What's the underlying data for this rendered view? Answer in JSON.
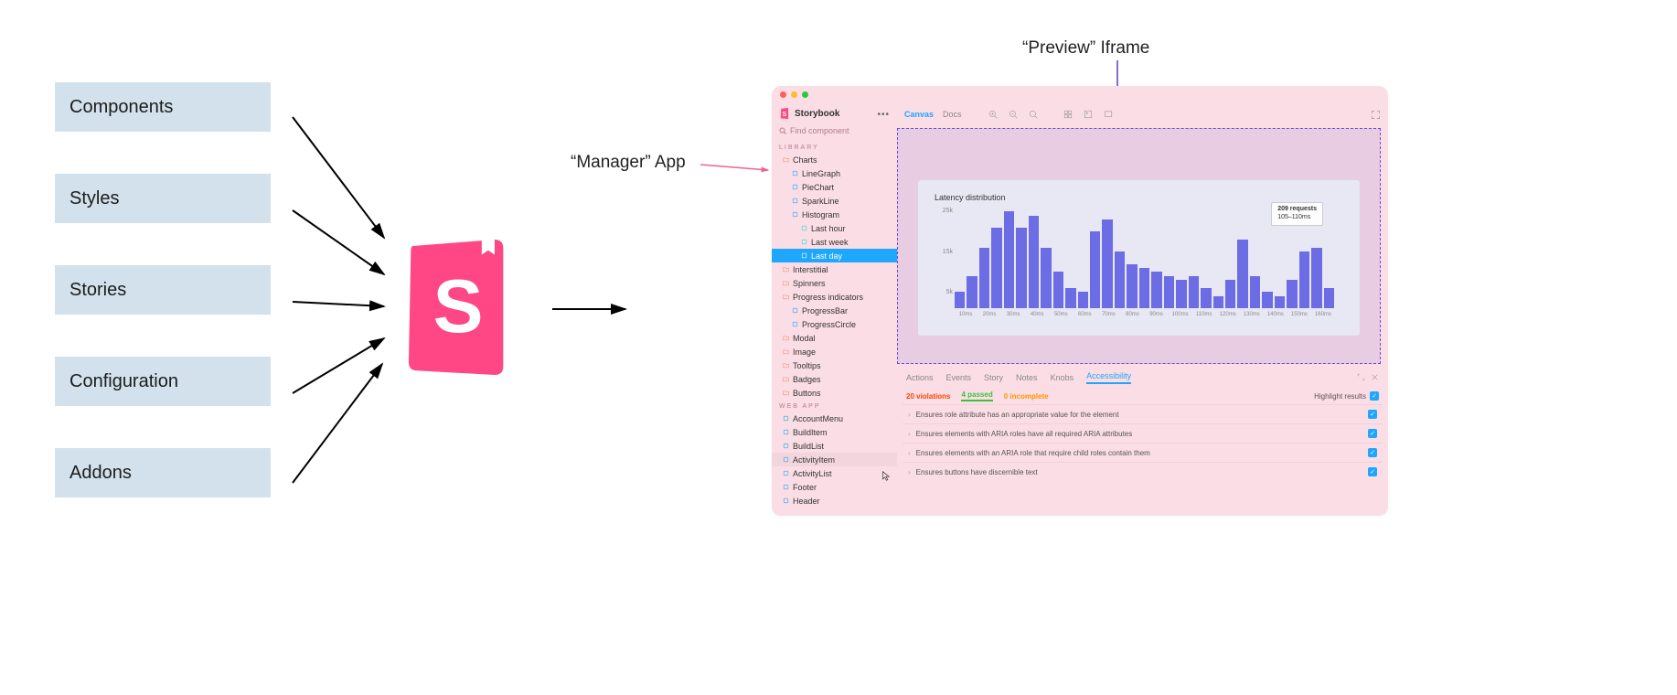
{
  "inputs": [
    "Components",
    "Styles",
    "Stories",
    "Configuration",
    "Addons"
  ],
  "labels": {
    "manager": "“Manager” App",
    "preview": "“Preview” Iframe"
  },
  "app": {
    "title": "Storybook",
    "search_placeholder": "Find component",
    "menu_dots": "•••",
    "sections": {
      "library_header": "LIBRARY",
      "webapp_header": "WEB APP"
    },
    "library": [
      {
        "label": "Charts",
        "indent": 0,
        "icon": "folder"
      },
      {
        "label": "LineGraph",
        "indent": 1,
        "icon": "component"
      },
      {
        "label": "PieChart",
        "indent": 1,
        "icon": "component"
      },
      {
        "label": "SparkLine",
        "indent": 1,
        "icon": "component"
      },
      {
        "label": "Histogram",
        "indent": 1,
        "icon": "component-open"
      },
      {
        "label": "Last hour",
        "indent": 2,
        "icon": "story"
      },
      {
        "label": "Last week",
        "indent": 2,
        "icon": "story"
      },
      {
        "label": "Last day",
        "indent": 2,
        "icon": "story",
        "selected": true
      },
      {
        "label": "Interstitial",
        "indent": 0,
        "icon": "folder"
      },
      {
        "label": "Spinners",
        "indent": 0,
        "icon": "folder"
      },
      {
        "label": "Progress indicators",
        "indent": 0,
        "icon": "folder-open"
      },
      {
        "label": "ProgressBar",
        "indent": 1,
        "icon": "component"
      },
      {
        "label": "ProgressCircle",
        "indent": 1,
        "icon": "component"
      },
      {
        "label": "Modal",
        "indent": 0,
        "icon": "folder"
      },
      {
        "label": "Image",
        "indent": 0,
        "icon": "folder"
      },
      {
        "label": "Tooltips",
        "indent": 0,
        "icon": "folder"
      },
      {
        "label": "Badges",
        "indent": 0,
        "icon": "folder"
      },
      {
        "label": "Buttons",
        "indent": 0,
        "icon": "folder"
      }
    ],
    "webapp": [
      {
        "label": "AccountMenu",
        "icon": "component"
      },
      {
        "label": "BuildItem",
        "icon": "component"
      },
      {
        "label": "BuildList",
        "icon": "component"
      },
      {
        "label": "ActivityItem",
        "icon": "component",
        "hover": true
      },
      {
        "label": "ActivityList",
        "icon": "component"
      },
      {
        "label": "Footer",
        "icon": "component"
      },
      {
        "label": "Header",
        "icon": "component"
      }
    ],
    "toolbar": {
      "canvas": "Canvas",
      "docs": "Docs",
      "icons": [
        "zoom-in-icon",
        "zoom-out-icon",
        "zoom-reset-icon",
        "grid-icon",
        "background-icon",
        "viewport-icon"
      ],
      "fullscreen_icon": "fullscreen-icon"
    },
    "addons": {
      "tabs": [
        "Actions",
        "Events",
        "Story",
        "Notes",
        "Knobs",
        "Accessibility"
      ],
      "active_tab": "Accessibility",
      "counts": {
        "violations": "20 violations",
        "passed": "4 passed",
        "incomplete": "0 incomplete"
      },
      "highlight_label": "Highlight results",
      "right_icons": [
        "expand-icon",
        "close-icon"
      ],
      "rows": [
        "Ensures role attribute has an appropriate value for the element",
        "Ensures elements with ARIA roles have all required ARIA attributes",
        "Ensures elements with an ARIA role that require child roles contain them",
        "Ensures buttons have discernible text"
      ]
    }
  },
  "chart_data": {
    "type": "bar",
    "title": "Latency distribution",
    "ylabel": "",
    "xlabel": "",
    "ylim": [
      0,
      25000
    ],
    "y_ticks": [
      "25k",
      "15k",
      "5k"
    ],
    "categories": [
      "10ms",
      "20ms",
      "30ms",
      "40ms",
      "50ms",
      "60ms",
      "70ms",
      "80ms",
      "90ms",
      "100ms",
      "110ms",
      "120ms",
      "130ms",
      "140ms",
      "150ms",
      "160ms"
    ],
    "values": [
      4000,
      8000,
      15000,
      20000,
      24000,
      20000,
      23000,
      15000,
      9000,
      5000,
      4000,
      19000,
      22000,
      14000,
      11000,
      10000,
      9000,
      8000,
      7000,
      8000,
      5000,
      3000,
      7000,
      17000,
      8000,
      4000,
      3000,
      7000,
      14000,
      15000,
      5000
    ],
    "tooltip": {
      "headline": "209 requests",
      "sub": "105–110ms"
    }
  }
}
